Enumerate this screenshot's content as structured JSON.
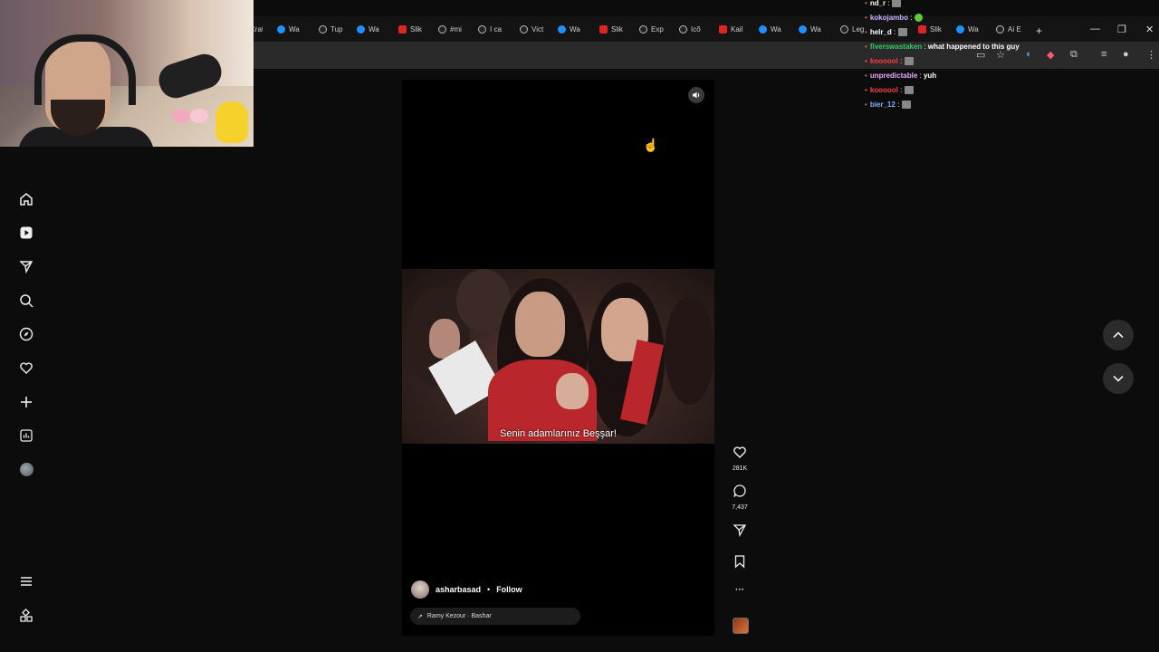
{
  "browser": {
    "tabs": [
      {
        "label": "Crat",
        "icon": "meta"
      },
      {
        "label": "Wa",
        "icon": "meta"
      },
      {
        "label": "Tup",
        "icon": "tiktok"
      },
      {
        "label": "Wa",
        "icon": "meta"
      },
      {
        "label": "Slik",
        "icon": "youtube"
      },
      {
        "label": "#mi",
        "icon": "tiktok"
      },
      {
        "label": "I ca",
        "icon": "tiktok"
      },
      {
        "label": "Vict",
        "icon": "tiktok"
      },
      {
        "label": "Wa",
        "icon": "meta"
      },
      {
        "label": "Slik",
        "icon": "youtube"
      },
      {
        "label": "Exp",
        "icon": "tiktok"
      },
      {
        "label": "Icõ",
        "icon": "tiktok"
      },
      {
        "label": "Kail",
        "icon": "youtube"
      },
      {
        "label": "Wa",
        "icon": "meta"
      },
      {
        "label": "Wa",
        "icon": "meta"
      },
      {
        "label": "Leg",
        "icon": "tiktok"
      },
      {
        "label": "Slik",
        "icon": "youtube"
      },
      {
        "label": "Wa",
        "icon": "meta"
      },
      {
        "label": "Ai E",
        "icon": "tiktok"
      }
    ],
    "new_tab": "+",
    "window_controls": {
      "minimize": "—",
      "restore": "❐",
      "close": "✕"
    }
  },
  "sidebar": {
    "items": [
      "home-icon",
      "reels-icon",
      "messages-icon",
      "search-icon",
      "explore-icon",
      "notifications-icon",
      "create-icon",
      "dashboard-icon",
      "profile-avatar"
    ],
    "bottom": [
      "menu-icon",
      "apps-icon"
    ]
  },
  "reel": {
    "subtitle": "Senin adamlarınız Beşşar!",
    "username": "asharbasad",
    "separator": "•",
    "follow_label": "Follow",
    "audio_arrow": "↗",
    "audio": "Ramy Kezour · Bashar"
  },
  "actions": {
    "likes": "281K",
    "comments": "7,437",
    "more": "···"
  },
  "chat": [
    {
      "user": "nd_r",
      "color": "#ffffff",
      "text": "",
      "emote": "badge"
    },
    {
      "user": "kokojambo",
      "color": "#c9b2ff",
      "text": "",
      "emote": "green"
    },
    {
      "user": "helr_d",
      "color": "#ffffff",
      "text": "",
      "emote": "badge"
    },
    {
      "user": "fiverswastaken",
      "color": "#33cc66",
      "text": "what happened to this guy",
      "emote": ""
    },
    {
      "user": "koooool",
      "color": "#ff3b3b",
      "text": "",
      "emote": "badge"
    },
    {
      "user": "unpredictable",
      "color": "#e7a8ff",
      "text": "yuh",
      "emote": ""
    },
    {
      "user": "koooool",
      "color": "#ff3b3b",
      "text": "",
      "emote": "badge"
    },
    {
      "user": "bier_12",
      "color": "#7fb2ff",
      "text": "",
      "emote": "badge"
    }
  ]
}
